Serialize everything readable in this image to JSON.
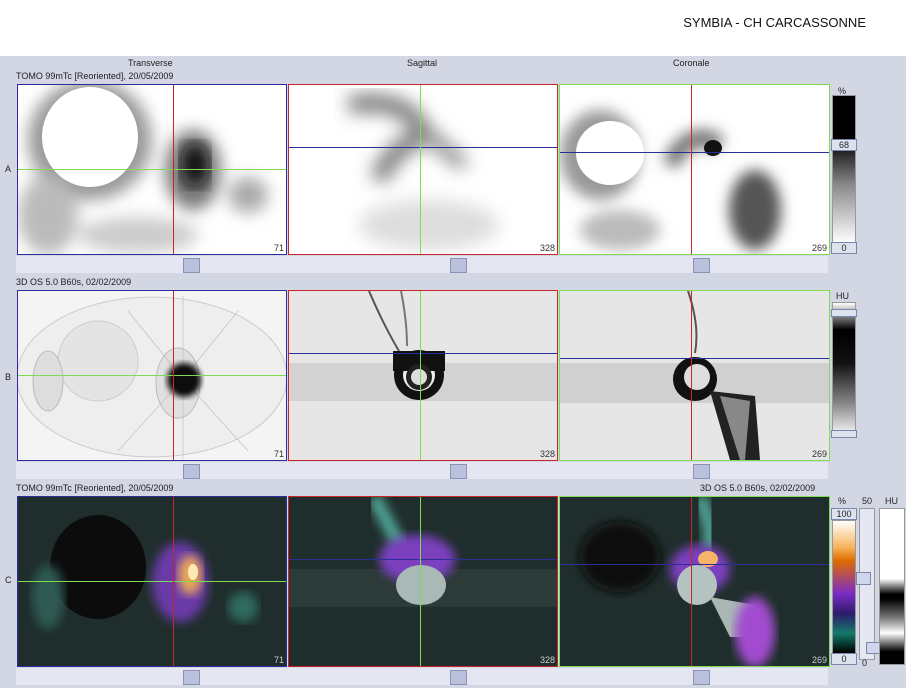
{
  "header": {
    "site": "SYMBIA - CH CARCASSONNE"
  },
  "columns": {
    "transverse": "Transverse",
    "sagittal": "Sagittal",
    "coronal": "Coronale"
  },
  "rows": {
    "a": {
      "label": "A",
      "series": "TOMO 99mTc [Reoriented], 20/05/2009"
    },
    "b": {
      "label": "B",
      "series": "3D  OS  5.0  B60s, 02/02/2009"
    },
    "c": {
      "label": "C",
      "series_left": "TOMO 99mTc [Reoriented], 20/05/2009",
      "series_right": "3D  OS  5.0  B60s, 02/02/2009"
    }
  },
  "slices": {
    "transverse": "71",
    "sagittal": "328",
    "coronal": "269"
  },
  "scales": {
    "a": {
      "unit": "%",
      "top": "68",
      "bottom": "0"
    },
    "b": {
      "unit": "HU"
    },
    "c": {
      "unit_left": "%",
      "top_left": "100",
      "bottom_left": "0",
      "slider_value": "50",
      "unit_right": "HU",
      "slider_min": "0"
    }
  },
  "colors": {
    "panel": "#d3d7e4",
    "crosshair_vertical": "#c8262a",
    "crosshair_horizontal_transverse": "#7fdc52",
    "crosshair_horizontal_other": "#2c2c9a"
  }
}
